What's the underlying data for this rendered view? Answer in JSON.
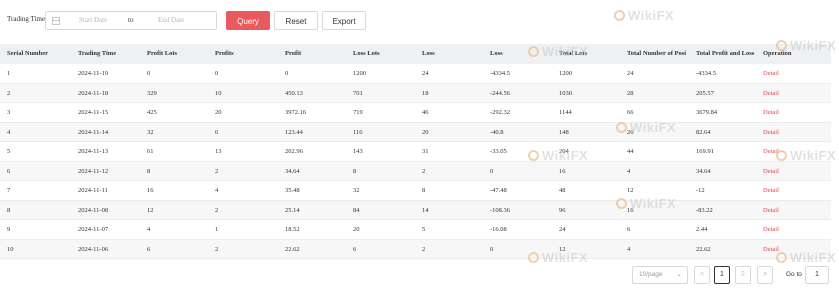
{
  "filter": {
    "label": "Trading Time",
    "start_placeholder": "Start Date",
    "separator": "to",
    "end_placeholder": "End Date"
  },
  "buttons": {
    "query": "Query",
    "reset": "Reset",
    "export": "Export"
  },
  "table": {
    "headers": [
      "Serial Number",
      "Trading Time",
      "Profit Lots",
      "Profits",
      "Profit",
      "Loss Lots",
      "Loss",
      "Loss",
      "Total Lots",
      "Total Number of Posi",
      "Total Profit and Loss",
      "Operation"
    ],
    "rows": [
      [
        "1",
        "2024-11-19",
        "0",
        "0",
        "0",
        "1200",
        "24",
        "-4334.5",
        "1200",
        "24",
        "-4334.5",
        "Detail"
      ],
      [
        "2",
        "2024-11-18",
        "329",
        "10",
        "450.13",
        "701",
        "18",
        "-244.56",
        "1030",
        "28",
        "205.57",
        "Detail"
      ],
      [
        "3",
        "2024-11-15",
        "425",
        "20",
        "3972.16",
        "719",
        "46",
        "-292.32",
        "1144",
        "66",
        "3679.84",
        "Detail"
      ],
      [
        "4",
        "2024-11-14",
        "32",
        "6",
        "123.44",
        "116",
        "20",
        "-40.8",
        "148",
        "26",
        "82.64",
        "Detail"
      ],
      [
        "5",
        "2024-11-13",
        "61",
        "13",
        "202.96",
        "143",
        "31",
        "-33.05",
        "204",
        "44",
        "169.91",
        "Detail"
      ],
      [
        "6",
        "2024-11-12",
        "8",
        "2",
        "34.64",
        "8",
        "2",
        "0",
        "16",
        "4",
        "34.64",
        "Detail"
      ],
      [
        "7",
        "2024-11-11",
        "16",
        "4",
        "35.48",
        "32",
        "8",
        "-47.48",
        "48",
        "12",
        "-12",
        "Detail"
      ],
      [
        "8",
        "2024-11-08",
        "12",
        "2",
        "25.14",
        "84",
        "14",
        "-108.36",
        "96",
        "16",
        "-83.22",
        "Detail"
      ],
      [
        "9",
        "2024-11-07",
        "4",
        "1",
        "18.52",
        "20",
        "5",
        "-16.08",
        "24",
        "6",
        "2.44",
        "Detail"
      ],
      [
        "10",
        "2024-11-06",
        "6",
        "2",
        "22.62",
        "6",
        "2",
        "0",
        "12",
        "4",
        "22.62",
        "Detail"
      ]
    ]
  },
  "pagination": {
    "page_size": "10/page",
    "prev": "<",
    "pages": [
      "1",
      "2"
    ],
    "next": ">",
    "goto_label": "Go to",
    "goto_value": "1"
  },
  "watermark": {
    "text": "WikiFX"
  }
}
